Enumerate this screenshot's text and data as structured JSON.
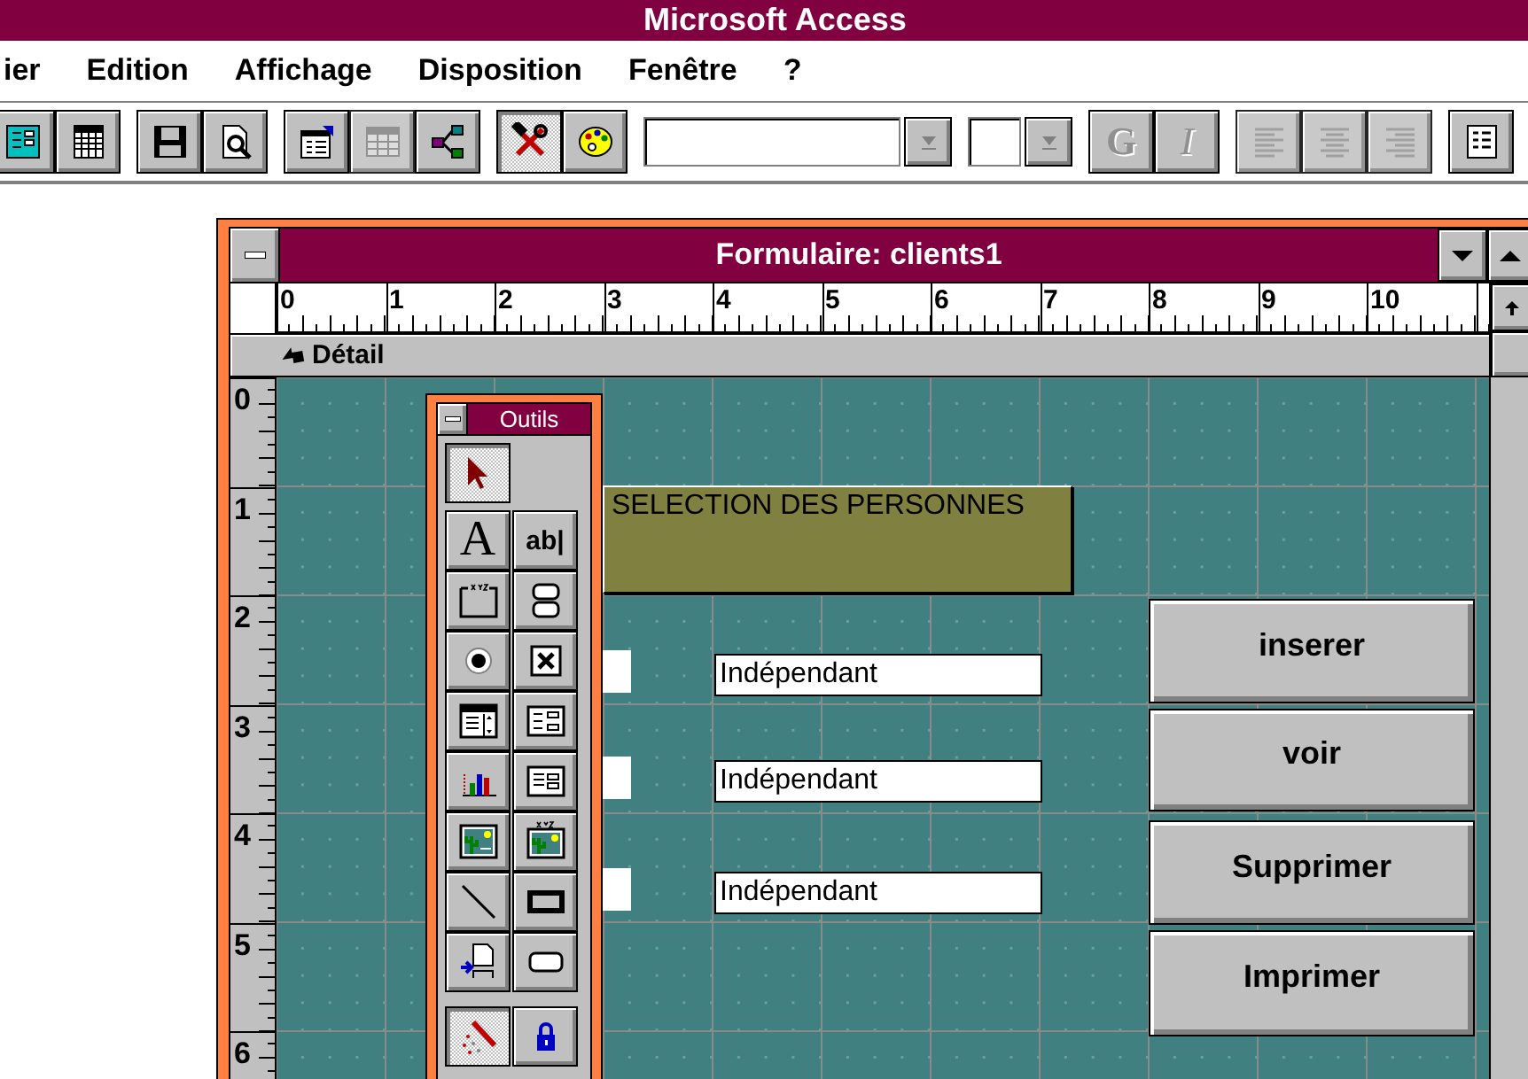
{
  "window": {
    "title": "Microsoft Access"
  },
  "menu": [
    {
      "label": "ier"
    },
    {
      "label": "Edition"
    },
    {
      "label": "Affichage"
    },
    {
      "label": "Disposition"
    },
    {
      "label": "Fenêtre"
    },
    {
      "label": "?"
    }
  ],
  "toolbar": [
    [
      {
        "kind": "form",
        "pressed": false,
        "disabled": false
      },
      {
        "kind": "datasheet",
        "pressed": false,
        "disabled": false
      }
    ],
    [
      {
        "kind": "save",
        "pressed": false,
        "disabled": false
      },
      {
        "kind": "preview",
        "pressed": false,
        "disabled": false
      }
    ],
    [
      {
        "kind": "properties",
        "pressed": false,
        "disabled": false
      },
      {
        "kind": "fieldlist",
        "pressed": false,
        "disabled": true
      },
      {
        "kind": "relations",
        "pressed": false,
        "disabled": false
      }
    ],
    [
      {
        "kind": "tools",
        "pressed": true,
        "disabled": false
      },
      {
        "kind": "palette",
        "pressed": false,
        "disabled": false
      }
    ],
    [
      {
        "kind": "combo"
      }
    ],
    [
      {
        "kind": "combo"
      }
    ],
    [
      {
        "kind": "bold",
        "glyph": "G",
        "pressed": false,
        "disabled": true
      },
      {
        "kind": "italic",
        "glyph": "I",
        "pressed": false,
        "disabled": true
      }
    ],
    [
      {
        "kind": "align-left",
        "pressed": false,
        "disabled": true
      },
      {
        "kind": "align-center",
        "pressed": false,
        "disabled": true
      },
      {
        "kind": "align-right",
        "pressed": false,
        "disabled": true
      }
    ],
    [
      {
        "kind": "list",
        "pressed": false,
        "disabled": false
      }
    ]
  ],
  "form": {
    "title": "Formulaire: clients1",
    "ruler_h": [
      "0",
      "1",
      "2",
      "3",
      "4",
      "5",
      "6",
      "7",
      "8",
      "9",
      "10"
    ],
    "ruler_v": [
      "0",
      "1",
      "2",
      "3",
      "4",
      "5",
      "6"
    ],
    "section": "Détail",
    "label": "SELECTION DES PERSONNES",
    "fields": [
      {
        "value": "Indépendant"
      },
      {
        "value": "Indépendant"
      },
      {
        "value": "Indépendant"
      }
    ],
    "buttons": [
      "inserer",
      "voir",
      "Supprimer",
      "Imprimer"
    ]
  },
  "toolbox": {
    "title": "Outils",
    "groups": [
      [
        {
          "kind": "pointer",
          "pressed": true
        }
      ],
      [
        {
          "kind": "label",
          "glyph": "A",
          "pressed": false
        },
        {
          "kind": "textbox",
          "glyph": "ab|",
          "pressed": false
        },
        {
          "kind": "option-group",
          "pressed": false
        },
        {
          "kind": "toggle",
          "pressed": false
        },
        {
          "kind": "radio"
        },
        {
          "kind": "checkbox"
        },
        {
          "kind": "combo",
          "pressed": false
        },
        {
          "kind": "listbox",
          "pressed": false
        },
        {
          "kind": "chart",
          "pressed": false
        },
        {
          "kind": "subform",
          "pressed": false
        },
        {
          "kind": "object-frame",
          "pressed": false
        },
        {
          "kind": "bound-frame",
          "pressed": false
        },
        {
          "kind": "line",
          "pressed": false
        },
        {
          "kind": "rectangle",
          "pressed": false
        },
        {
          "kind": "page-break",
          "pressed": false
        },
        {
          "kind": "command-button",
          "pressed": false
        }
      ],
      [
        {
          "kind": "wizard",
          "pressed": true
        },
        {
          "kind": "lock",
          "pressed": false
        }
      ]
    ]
  }
}
